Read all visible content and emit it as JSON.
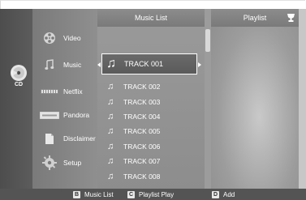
{
  "disc": {
    "label": "CD",
    "icon": "cd-disc-icon"
  },
  "menu": {
    "items": [
      {
        "label": "Video",
        "icon": "film-reel-icon"
      },
      {
        "label": "Music",
        "icon": "music-note-icon"
      },
      {
        "label": "Netflix",
        "icon": "netflix-logo-icon"
      },
      {
        "label": "Pandora",
        "icon": "pandora-logo-icon"
      },
      {
        "label": "Disclaimer",
        "icon": "document-icon"
      },
      {
        "label": "Setup",
        "icon": "gear-icon"
      }
    ],
    "selected": "Music"
  },
  "music_list": {
    "title": "Music List",
    "selected_track": "TRACK 001",
    "tracks": [
      "TRACK 001",
      "TRACK 002",
      "TRACK 003",
      "TRACK 004",
      "TRACK 005",
      "TRACK 006",
      "TRACK 007",
      "TRACK 008"
    ]
  },
  "playlist": {
    "title": "Playlist",
    "icon": "trophy-icon"
  },
  "footer": {
    "hints": [
      {
        "key": "B",
        "label": "Music List"
      },
      {
        "key": "C",
        "label": "Playlist Play"
      },
      {
        "key": "D",
        "label": "Add"
      }
    ]
  },
  "colors": {
    "highlight_border": "#ffffff",
    "panel_gray": "#8d8d8d",
    "bottom_bar": "#545454"
  }
}
